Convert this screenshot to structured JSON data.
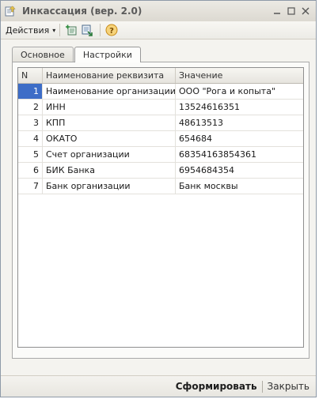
{
  "window": {
    "title": "Инкассация (вер. 2.0)",
    "controls": [
      "minimize",
      "maximize",
      "close"
    ]
  },
  "toolbar": {
    "actions_label": "Действия",
    "actions_arrow": "▾",
    "icons": [
      "add-row-icon",
      "load-icon",
      "help-icon"
    ]
  },
  "tabs": [
    {
      "label": "Основное",
      "active": false
    },
    {
      "label": "Настройки",
      "active": true
    }
  ],
  "table": {
    "headers": [
      "N",
      "Наименование реквизита",
      "Значение"
    ],
    "rows": [
      {
        "n": "1",
        "name": "Наименование организации",
        "value": "ООО \"Рога и копыта\""
      },
      {
        "n": "2",
        "name": "ИНН",
        "value": "13524616351"
      },
      {
        "n": "3",
        "name": "КПП",
        "value": "48613513"
      },
      {
        "n": "4",
        "name": "ОКАТО",
        "value": "654684"
      },
      {
        "n": "5",
        "name": "Счет организации",
        "value": "68354163854361"
      },
      {
        "n": "6",
        "name": "БИК Банка",
        "value": "6954684354"
      },
      {
        "n": "7",
        "name": "Банк организации",
        "value": "Банк москвы"
      }
    ],
    "selected_row": 1
  },
  "footer": {
    "generate_label": "Сформировать",
    "close_label": "Закрыть"
  },
  "colors": {
    "selection": "#3d6dc7",
    "help_icon": "#e8a020"
  }
}
